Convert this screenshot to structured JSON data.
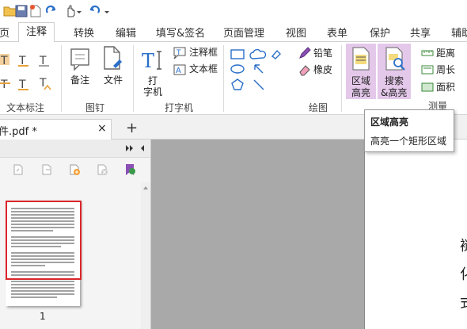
{
  "ribbon_tabs": [
    "页",
    "注释",
    "转换",
    "编辑",
    "填写&签名",
    "页面管理",
    "视图",
    "表单",
    "保护",
    "共享",
    "辅助"
  ],
  "active_tab": "注释",
  "groups": {
    "text_markup": "文本标注",
    "pin": "图钉",
    "typewriter": "打字机",
    "drawing": "绘图",
    "measure": "测量"
  },
  "buttons": {
    "note": "备注",
    "file": "文件",
    "typewriter_line1": "打",
    "typewriter_line2": "字机",
    "callout": "注释框",
    "textbox": "文本框",
    "pencil": "铅笔",
    "eraser": "橡皮",
    "area_highlight_line1": "区域",
    "area_highlight_line2": "高亮",
    "search_highlight_line1": "搜索",
    "search_highlight_line2": "&高亮",
    "distance": "距离",
    "perimeter": "周长",
    "area": "面积"
  },
  "document_tab": {
    "title": "件.pdf *",
    "close": "×",
    "add": "+"
  },
  "thumbnail": {
    "page_number": "1"
  },
  "tooltip": {
    "title": "区域高亮",
    "description": "高亮一个矩形区域"
  },
  "document_visible_chars": [
    "褪",
    "化",
    "式"
  ],
  "colors": {
    "accent_highlight": "#e4c8ea",
    "text_markup_icon": "#e8a23c",
    "thumbnail_border": "#d9262b"
  }
}
